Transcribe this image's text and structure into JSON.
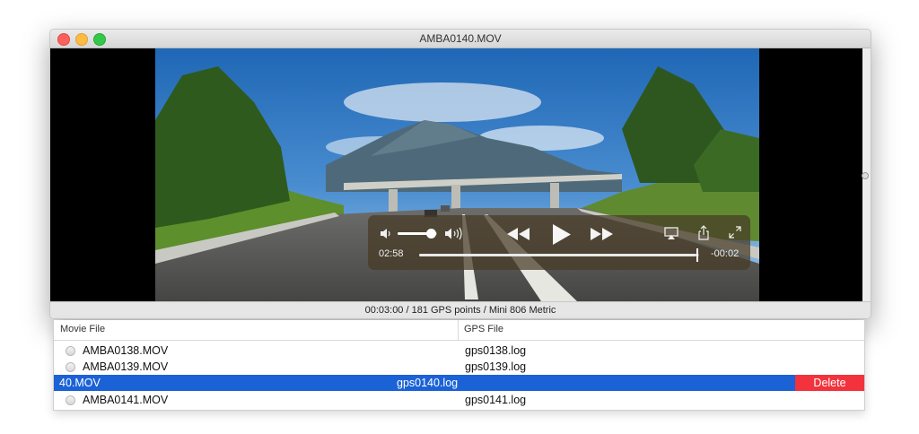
{
  "window": {
    "title": "AMBA0140.MOV"
  },
  "player": {
    "elapsed": "02:58",
    "remaining": "-00:02",
    "progress_fraction": 0.99,
    "volume_fraction": 0.85
  },
  "status_bar": {
    "text": "00:03:00 / 181 GPS points / Mini 806 Metric"
  },
  "table": {
    "columns": {
      "movie": "Movie File",
      "gps": "GPS File"
    },
    "rows": [
      {
        "movie": "AMBA0138.MOV",
        "gps": "gps0138.log"
      },
      {
        "movie": "AMBA0139.MOV",
        "gps": "gps0139.log"
      },
      {
        "movie": "40.MOV",
        "gps": "gps0140.log",
        "action": "Delete"
      },
      {
        "movie": "AMBA0141.MOV",
        "gps": "gps0141.log"
      }
    ]
  },
  "colors": {
    "selection": "#1b62d6",
    "delete": "#f2333d"
  }
}
